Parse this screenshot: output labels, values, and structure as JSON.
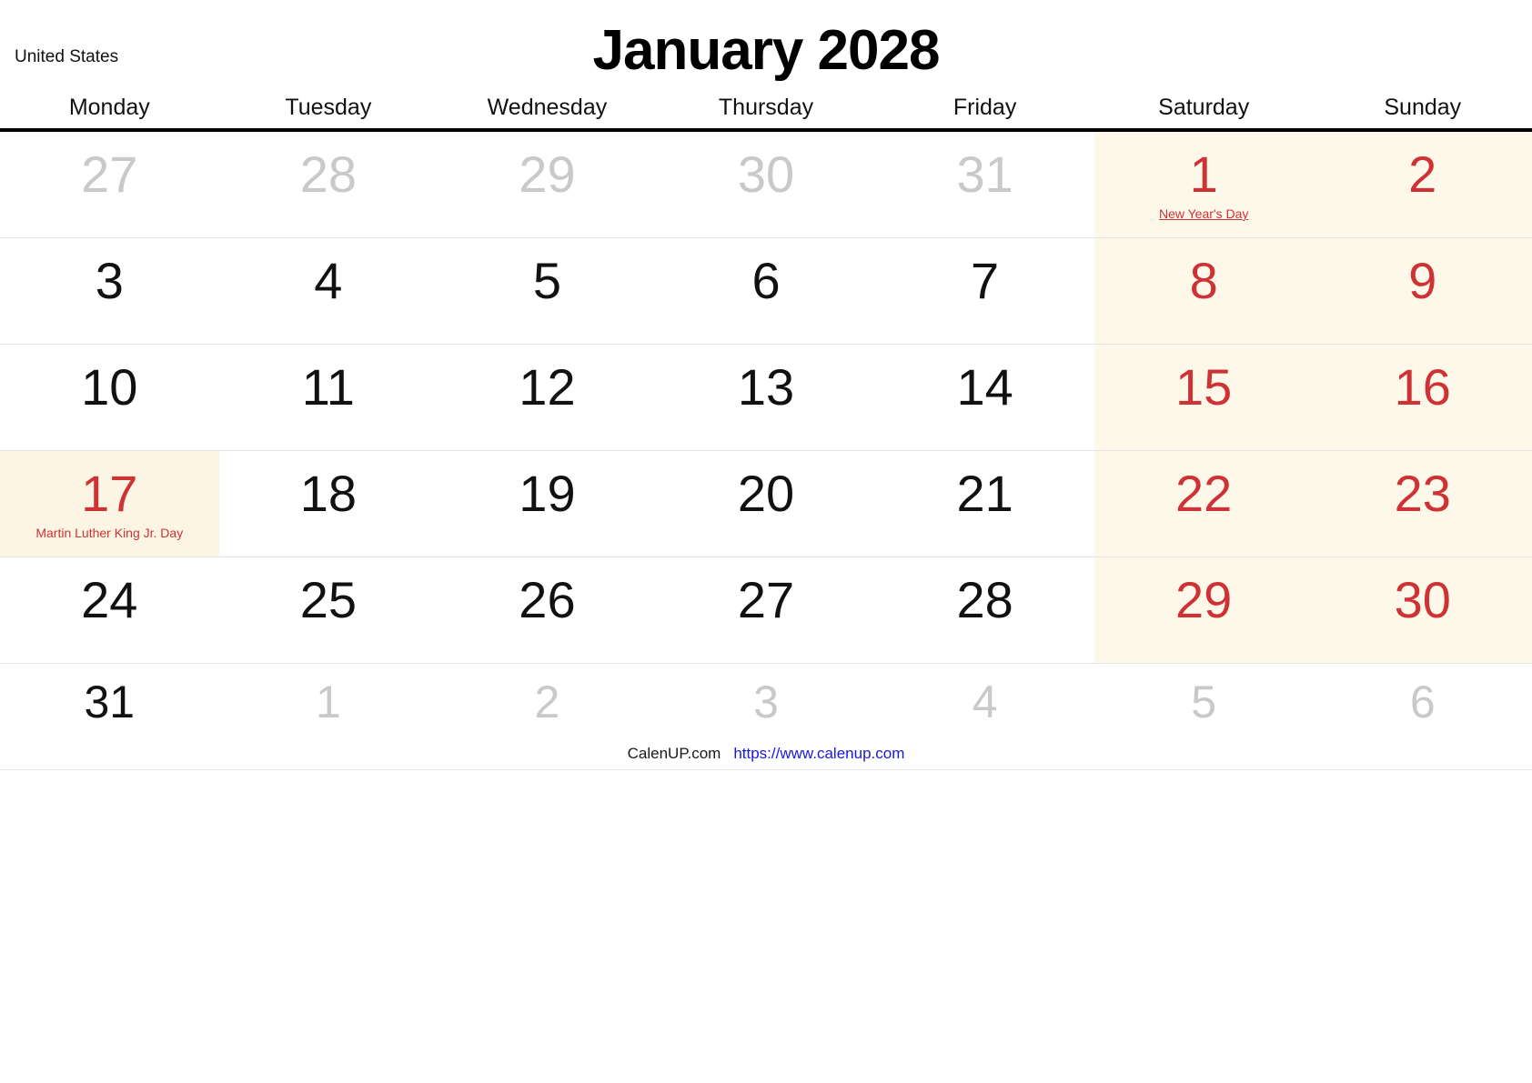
{
  "header": {
    "country": "United States",
    "title": "January 2028"
  },
  "weekdays": [
    {
      "label": "Monday",
      "weekend": false
    },
    {
      "label": "Tuesday",
      "weekend": false
    },
    {
      "label": "Wednesday",
      "weekend": false
    },
    {
      "label": "Thursday",
      "weekend": false
    },
    {
      "label": "Friday",
      "weekend": false
    },
    {
      "label": "Saturday",
      "weekend": true
    },
    {
      "label": "Sunday",
      "weekend": true
    }
  ],
  "colors": {
    "weekend_red": "#cf3234",
    "muted_gray": "#c9c9c9",
    "weekend_bg": "#fdf8ea",
    "holiday_bg": "#fdf5e4",
    "link_blue": "#1818e0",
    "header_rule": "#000000"
  },
  "weeks": [
    {
      "days": [
        {
          "num": "27",
          "style": "muted",
          "bg": "none",
          "holiday": ""
        },
        {
          "num": "28",
          "style": "muted",
          "bg": "none",
          "holiday": ""
        },
        {
          "num": "29",
          "style": "muted",
          "bg": "none",
          "holiday": ""
        },
        {
          "num": "30",
          "style": "muted",
          "bg": "none",
          "holiday": ""
        },
        {
          "num": "31",
          "style": "muted",
          "bg": "none",
          "holiday": ""
        },
        {
          "num": "1",
          "style": "red",
          "bg": "weekend",
          "holiday": "New Year's Day",
          "holiday_underline": true
        },
        {
          "num": "2",
          "style": "red",
          "bg": "weekend",
          "holiday": ""
        }
      ]
    },
    {
      "days": [
        {
          "num": "3",
          "style": "normal",
          "bg": "none",
          "holiday": ""
        },
        {
          "num": "4",
          "style": "normal",
          "bg": "none",
          "holiday": ""
        },
        {
          "num": "5",
          "style": "normal",
          "bg": "none",
          "holiday": ""
        },
        {
          "num": "6",
          "style": "normal",
          "bg": "none",
          "holiday": ""
        },
        {
          "num": "7",
          "style": "normal",
          "bg": "none",
          "holiday": ""
        },
        {
          "num": "8",
          "style": "red",
          "bg": "weekend",
          "holiday": ""
        },
        {
          "num": "9",
          "style": "red",
          "bg": "weekend",
          "holiday": ""
        }
      ]
    },
    {
      "days": [
        {
          "num": "10",
          "style": "normal",
          "bg": "none",
          "holiday": ""
        },
        {
          "num": "11",
          "style": "normal",
          "bg": "none",
          "holiday": ""
        },
        {
          "num": "12",
          "style": "normal",
          "bg": "none",
          "holiday": ""
        },
        {
          "num": "13",
          "style": "normal",
          "bg": "none",
          "holiday": ""
        },
        {
          "num": "14",
          "style": "normal",
          "bg": "none",
          "holiday": ""
        },
        {
          "num": "15",
          "style": "red",
          "bg": "weekend",
          "holiday": ""
        },
        {
          "num": "16",
          "style": "red",
          "bg": "weekend",
          "holiday": ""
        }
      ]
    },
    {
      "days": [
        {
          "num": "17",
          "style": "red",
          "bg": "holiday",
          "holiday": "Martin Luther King Jr. Day",
          "holiday_underline": false
        },
        {
          "num": "18",
          "style": "normal",
          "bg": "none",
          "holiday": ""
        },
        {
          "num": "19",
          "style": "normal",
          "bg": "none",
          "holiday": ""
        },
        {
          "num": "20",
          "style": "normal",
          "bg": "none",
          "holiday": ""
        },
        {
          "num": "21",
          "style": "normal",
          "bg": "none",
          "holiday": ""
        },
        {
          "num": "22",
          "style": "red",
          "bg": "weekend",
          "holiday": ""
        },
        {
          "num": "23",
          "style": "red",
          "bg": "weekend",
          "holiday": ""
        }
      ]
    },
    {
      "days": [
        {
          "num": "24",
          "style": "normal",
          "bg": "none",
          "holiday": ""
        },
        {
          "num": "25",
          "style": "normal",
          "bg": "none",
          "holiday": ""
        },
        {
          "num": "26",
          "style": "normal",
          "bg": "none",
          "holiday": ""
        },
        {
          "num": "27",
          "style": "normal",
          "bg": "none",
          "holiday": ""
        },
        {
          "num": "28",
          "style": "normal",
          "bg": "none",
          "holiday": ""
        },
        {
          "num": "29",
          "style": "red",
          "bg": "weekend",
          "holiday": ""
        },
        {
          "num": "30",
          "style": "red",
          "bg": "weekend",
          "holiday": ""
        }
      ]
    },
    {
      "days": [
        {
          "num": "31",
          "style": "normal",
          "bg": "none",
          "holiday": ""
        },
        {
          "num": "1",
          "style": "muted",
          "bg": "none",
          "holiday": ""
        },
        {
          "num": "2",
          "style": "muted",
          "bg": "none",
          "holiday": ""
        },
        {
          "num": "3",
          "style": "muted",
          "bg": "none",
          "holiday": ""
        },
        {
          "num": "4",
          "style": "muted",
          "bg": "none",
          "holiday": ""
        },
        {
          "num": "5",
          "style": "muted",
          "bg": "none",
          "holiday": ""
        },
        {
          "num": "6",
          "style": "muted",
          "bg": "none",
          "holiday": ""
        }
      ]
    }
  ],
  "footer": {
    "brand": "CalenUP.com",
    "url": "https://www.calenup.com"
  }
}
